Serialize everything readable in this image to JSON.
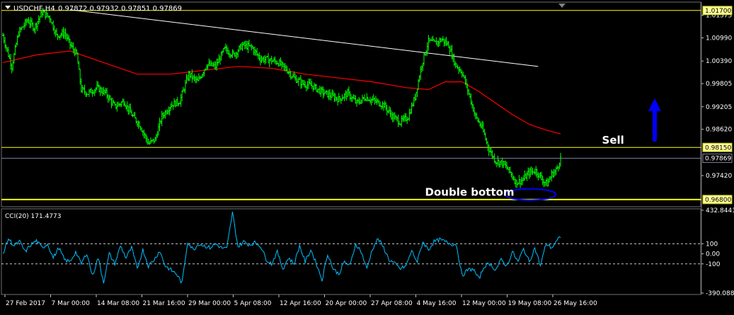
{
  "header": {
    "symbol_label": "USDCHF,H4",
    "ohlc_label": "0.97872 0.97932 0.97851 0.97869"
  },
  "indicator": {
    "label": "CCI(20) 171.4773"
  },
  "annotations": {
    "sell": "Sell",
    "double_bottom": "Double bottom"
  },
  "colors": {
    "background": "#000000",
    "candles": "#00ff00",
    "moving_average": "#ff0000",
    "trendline": "#ffffff",
    "horizontal_levels": "#ffff00",
    "current_price_line": "#8080a0",
    "arrow": "#0000ff",
    "ellipse": "#0000ff",
    "cci_line": "#00bfff",
    "axis_text": "#ffffff",
    "price_tag_background": "#ffff99"
  },
  "chart_data": [
    {
      "type": "line",
      "subtype": "ohlc-bars",
      "title": "USDCHF,H4",
      "ylim": [
        0.9665,
        1.0188
      ],
      "y_ticks": [
        "1.01575",
        "1.00990",
        "1.00390",
        "0.99805",
        "0.99205",
        "0.98620",
        "0.97420"
      ],
      "x_ticks": [
        "27 Feb 2017",
        "7 Mar 00:00",
        "14 Mar 08:00",
        "21 Mar 16:00",
        "29 Mar 00:00",
        "5 Apr 08:00",
        "12 Apr 16:00",
        "20 Apr 00:00",
        "27 Apr 08:00",
        "4 May 16:00",
        "12 May 00:00",
        "19 May 08:00",
        "26 May 16:00"
      ],
      "levels": [
        {
          "label": "1.01700",
          "value": 1.017
        },
        {
          "label": "0.98150",
          "value": 0.9815
        },
        {
          "label": "0.96800",
          "value": 0.968
        }
      ],
      "current_price": {
        "label": "0.97869",
        "value": 0.97869
      },
      "price_anchors": [
        [
          0,
          1.0105
        ],
        [
          8,
          1.0025
        ],
        [
          14,
          1.0112
        ],
        [
          22,
          1.0145
        ],
        [
          28,
          1.0125
        ],
        [
          35,
          1.0165
        ],
        [
          42,
          1.0152
        ],
        [
          48,
          1.0105
        ],
        [
          55,
          1.0112
        ],
        [
          60,
          1.0082
        ],
        [
          66,
          1.0055
        ],
        [
          70,
          0.9965
        ],
        [
          76,
          0.9955
        ],
        [
          84,
          0.997
        ],
        [
          92,
          0.9955
        ],
        [
          100,
          0.992
        ],
        [
          108,
          0.9935
        ],
        [
          116,
          0.9895
        ],
        [
          122,
          0.9875
        ],
        [
          130,
          0.9825
        ],
        [
          136,
          0.9835
        ],
        [
          142,
          0.9895
        ],
        [
          150,
          0.9925
        ],
        [
          158,
          0.9935
        ],
        [
          166,
          1.0005
        ],
        [
          174,
          0.9985
        ],
        [
          182,
          1.003
        ],
        [
          190,
          1.0025
        ],
        [
          198,
          1.007
        ],
        [
          206,
          1.0055
        ],
        [
          214,
          1.008
        ],
        [
          222,
          1.0075
        ],
        [
          230,
          1.0045
        ],
        [
          238,
          1.0042
        ],
        [
          246,
          1.0035
        ],
        [
          254,
          1.0015
        ],
        [
          260,
          0.9995
        ],
        [
          268,
          0.998
        ],
        [
          276,
          0.9975
        ],
        [
          284,
          0.996
        ],
        [
          292,
          0.995
        ],
        [
          300,
          0.994
        ],
        [
          308,
          0.9955
        ],
        [
          316,
          0.993
        ],
        [
          324,
          0.9945
        ],
        [
          332,
          0.9935
        ],
        [
          340,
          0.9925
        ],
        [
          348,
          0.9895
        ],
        [
          355,
          0.988
        ],
        [
          362,
          0.9895
        ],
        [
          368,
          0.9945
        ],
        [
          374,
          1.003
        ],
        [
          380,
          1.009
        ],
        [
          386,
          1.0085
        ],
        [
          392,
          1.0095
        ],
        [
          398,
          1.008
        ],
        [
          404,
          1.003
        ],
        [
          410,
          1.001
        ],
        [
          416,
          0.9955
        ],
        [
          422,
          0.9895
        ],
        [
          428,
          0.9865
        ],
        [
          434,
          0.981
        ],
        [
          440,
          0.978
        ],
        [
          446,
          0.9775
        ],
        [
          452,
          0.9755
        ],
        [
          458,
          0.9725
        ],
        [
          464,
          0.973
        ],
        [
          470,
          0.975
        ],
        [
          476,
          0.9755
        ],
        [
          482,
          0.973
        ],
        [
          486,
          0.972
        ],
        [
          490,
          0.9745
        ],
        [
          494,
          0.9755
        ],
        [
          498,
          0.9787
        ]
      ],
      "moving_average": [
        [
          0,
          1.0035
        ],
        [
          30,
          1.0055
        ],
        [
          60,
          1.0065
        ],
        [
          90,
          1.0035
        ],
        [
          120,
          1.0005
        ],
        [
          150,
          1.0005
        ],
        [
          180,
          1.0015
        ],
        [
          210,
          1.0025
        ],
        [
          240,
          1.002
        ],
        [
          270,
          1.0005
        ],
        [
          300,
          0.9995
        ],
        [
          330,
          0.9985
        ],
        [
          360,
          0.997
        ],
        [
          380,
          0.9965
        ],
        [
          395,
          0.9985
        ],
        [
          410,
          0.9985
        ],
        [
          425,
          0.996
        ],
        [
          440,
          0.993
        ],
        [
          455,
          0.99
        ],
        [
          470,
          0.9875
        ],
        [
          485,
          0.986
        ],
        [
          498,
          0.985
        ]
      ],
      "trendline": {
        "from": [
          60,
          1.0172
        ],
        "to": [
          478,
          1.0025
        ]
      },
      "annotation_targets": {
        "sell_text": [
          535,
          0.9825
        ],
        "double_bottom_text": [
          377,
          0.969
        ],
        "arrow_from": [
          582,
          0.9835
        ],
        "arrow_to": [
          582,
          0.9935
        ],
        "ellipse_center": [
          471,
          0.9693
        ]
      }
    },
    {
      "type": "line",
      "title": "CCI(20) 171.4773",
      "ylim": [
        -390.0889,
        432.8441
      ],
      "y_ticks": [
        "432.8441",
        "100",
        "0.00",
        "-100",
        "-390.0889"
      ],
      "dashed_levels": [
        100,
        -100
      ],
      "current_value": 171.4773,
      "values_anchors": [
        [
          0,
          0
        ],
        [
          5,
          150
        ],
        [
          10,
          80
        ],
        [
          15,
          120
        ],
        [
          20,
          20
        ],
        [
          25,
          90
        ],
        [
          30,
          130
        ],
        [
          35,
          60
        ],
        [
          40,
          100
        ],
        [
          45,
          -40
        ],
        [
          50,
          60
        ],
        [
          55,
          -60
        ],
        [
          60,
          -80
        ],
        [
          65,
          20
        ],
        [
          70,
          -100
        ],
        [
          75,
          10
        ],
        [
          80,
          -220
        ],
        [
          85,
          -40
        ],
        [
          90,
          -280
        ],
        [
          95,
          0
        ],
        [
          100,
          -100
        ],
        [
          105,
          80
        ],
        [
          110,
          -40
        ],
        [
          115,
          60
        ],
        [
          120,
          -150
        ],
        [
          125,
          40
        ],
        [
          130,
          -120
        ],
        [
          135,
          -60
        ],
        [
          140,
          30
        ],
        [
          145,
          -120
        ],
        [
          150,
          -160
        ],
        [
          155,
          -200
        ],
        [
          160,
          -290
        ],
        [
          165,
          120
        ],
        [
          170,
          40
        ],
        [
          175,
          100
        ],
        [
          180,
          80
        ],
        [
          185,
          60
        ],
        [
          190,
          100
        ],
        [
          195,
          60
        ],
        [
          200,
          50
        ],
        [
          205,
          410
        ],
        [
          210,
          70
        ],
        [
          215,
          120
        ],
        [
          220,
          90
        ],
        [
          225,
          110
        ],
        [
          230,
          80
        ],
        [
          235,
          -50
        ],
        [
          240,
          -100
        ],
        [
          245,
          20
        ],
        [
          250,
          -150
        ],
        [
          255,
          -40
        ],
        [
          260,
          -100
        ],
        [
          265,
          80
        ],
        [
          270,
          -80
        ],
        [
          275,
          40
        ],
        [
          280,
          -100
        ],
        [
          285,
          -260
        ],
        [
          290,
          0
        ],
        [
          295,
          -150
        ],
        [
          300,
          -200
        ],
        [
          305,
          -80
        ],
        [
          310,
          -120
        ],
        [
          315,
          100
        ],
        [
          320,
          20
        ],
        [
          325,
          -150
        ],
        [
          330,
          50
        ],
        [
          335,
          150
        ],
        [
          340,
          60
        ],
        [
          345,
          -60
        ],
        [
          350,
          -100
        ],
        [
          355,
          -150
        ],
        [
          360,
          -120
        ],
        [
          365,
          30
        ],
        [
          370,
          -80
        ],
        [
          375,
          120
        ],
        [
          380,
          40
        ],
        [
          385,
          120
        ],
        [
          390,
          140
        ],
        [
          395,
          120
        ],
        [
          400,
          100
        ],
        [
          405,
          90
        ],
        [
          410,
          -220
        ],
        [
          415,
          -160
        ],
        [
          420,
          -150
        ],
        [
          425,
          -250
        ],
        [
          430,
          -120
        ],
        [
          435,
          -100
        ],
        [
          440,
          -160
        ],
        [
          445,
          -60
        ],
        [
          450,
          -120
        ],
        [
          455,
          20
        ],
        [
          460,
          -80
        ],
        [
          465,
          50
        ],
        [
          470,
          -80
        ],
        [
          475,
          60
        ],
        [
          480,
          -120
        ],
        [
          485,
          100
        ],
        [
          490,
          60
        ],
        [
          495,
          130
        ],
        [
          498,
          171
        ]
      ]
    }
  ]
}
